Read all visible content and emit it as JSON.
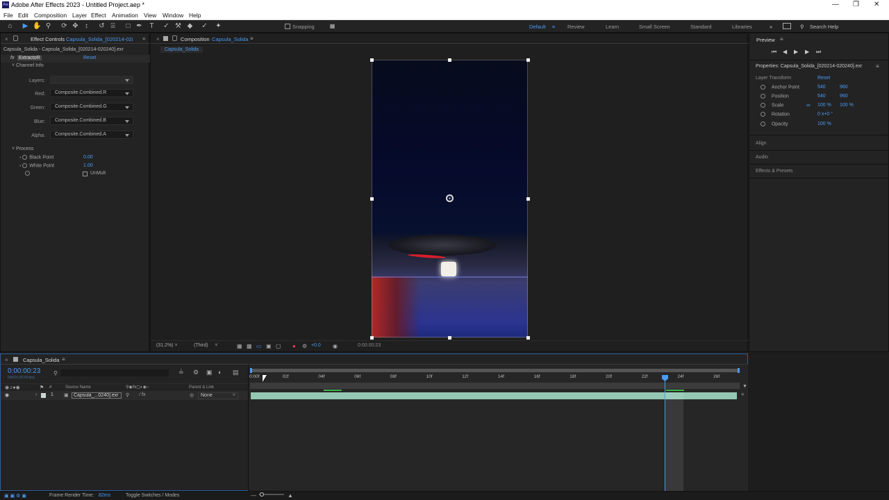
{
  "app": {
    "title": "Adobe After Effects 2023 - Untitled Project.aep *",
    "logo": "Ae"
  },
  "menu": [
    "File",
    "Edit",
    "Composition",
    "Layer",
    "Effect",
    "Animation",
    "View",
    "Window",
    "Help"
  ],
  "toolbar": {
    "snapping": "Snapping"
  },
  "workspaces": [
    "Default",
    "Review",
    "Learn",
    "Small Screen",
    "Standard",
    "Libraries"
  ],
  "search_help": "Search Help",
  "effect_controls": {
    "tab_label": "Effect Controls",
    "tab_layer": "Capsula_Solida_[020214-02(",
    "header": "Capsula_Solida - Capsula_Solida_[020214-020240].exr",
    "fx_badge": "fx",
    "effect_name": "ExtractoR",
    "reset": "Reset",
    "channel_info": "Channel Info",
    "layers_label": "Layers:",
    "red_label": "Red:",
    "red_value": "Composite.Combined.R",
    "green_label": "Green:",
    "green_value": "Composite.Combined.G",
    "blue_label": "Blue:",
    "blue_value": "Composite.Combined.B",
    "alpha_label": "Alpha:",
    "alpha_value": "Composite.Combined.A",
    "process": "Process",
    "black_point_label": "Black Point",
    "black_point": "0.00",
    "white_point_label": "White Point",
    "white_point": "1.00",
    "unmult": "UnMult"
  },
  "composition": {
    "tab_label": "Composition",
    "tab_name": "Capsula_Solida",
    "subtab": "Capsula_Solida",
    "zoom": "(31.2%)",
    "resolution": "(Third)",
    "exposure": "+0.0",
    "timecode": "0:00:00:23"
  },
  "preview": {
    "title": "Preview"
  },
  "properties": {
    "title": "Properties: Capsula_Solida_[020214-020240].exr",
    "section": "Layer Transform",
    "reset": "Reset",
    "anchor_label": "Anchor Point",
    "anchor": [
      "540",
      "960"
    ],
    "position_label": "Position",
    "position": [
      "540",
      "960"
    ],
    "scale_label": "Scale",
    "scale": [
      "100 %",
      "100 %"
    ],
    "rotation_label": "Rotation",
    "rotation": "0 x+0 °",
    "opacity_label": "Opacity",
    "opacity": "100 %"
  },
  "side_panels": [
    "Align",
    "Audio",
    "Effects & Presets"
  ],
  "timeline": {
    "tab_name": "Capsula_Solida",
    "timecode": "0:00:00:23",
    "timecode_sub": "00023 (30.00 fps)",
    "search_placeholder": "",
    "col_source": "Source Name",
    "col_parent": "Parent & Link",
    "layer_num": "1",
    "layer_name": "Capsula_...0240].exr",
    "parent_value": "None",
    "ruler": [
      "0:00f",
      "02f",
      "04f",
      "06f",
      "08f",
      "10f",
      "12f",
      "14f",
      "16f",
      "18f",
      "20f",
      "22f",
      "24f",
      "26f"
    ],
    "playhead_frame": 23
  },
  "statusbar": {
    "render_label": "Frame Render Time:",
    "render_value": "82ms",
    "toggle": "Toggle Switches / Modes"
  },
  "colors": {
    "accent": "#4a9bf5",
    "track": "#94c8b4",
    "panel": "#232323"
  }
}
